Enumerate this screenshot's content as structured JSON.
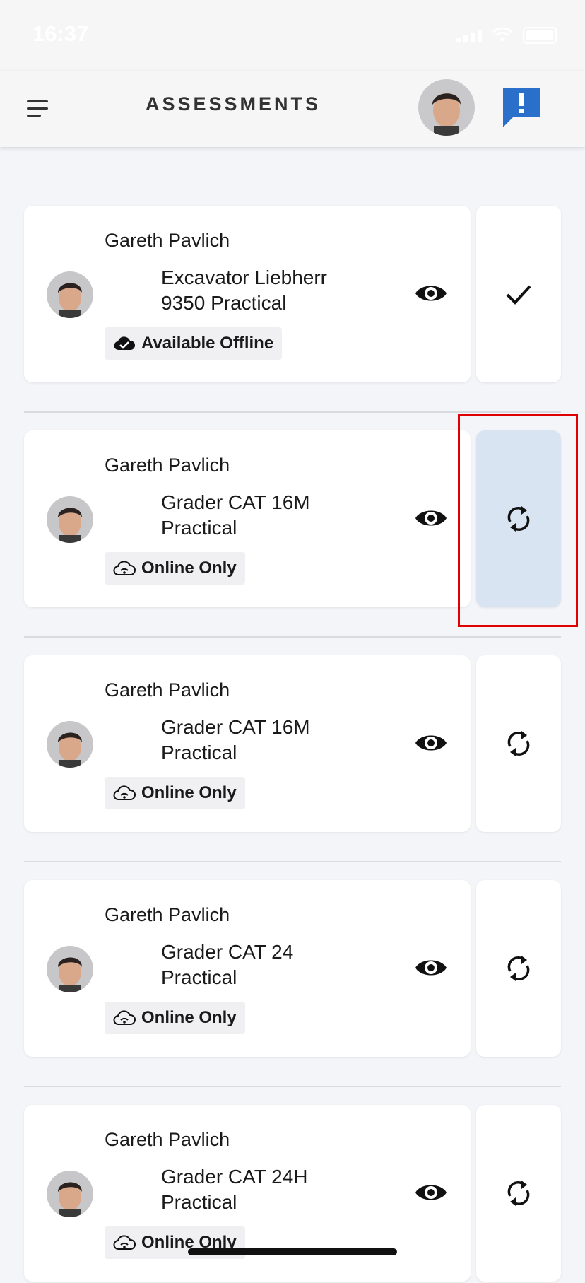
{
  "status_bar": {
    "time": "16:37"
  },
  "header": {
    "title": "ASSESSMENTS"
  },
  "assessments": [
    {
      "person": "Gareth Pavlich",
      "title": "Excavator Liebherr 9350 Practical",
      "status": "Available Offline",
      "status_icon": "cloud-check-icon",
      "action_icon": "check-icon"
    },
    {
      "person": "Gareth Pavlich",
      "title": "Grader CAT 16M Practical",
      "status": "Online Only",
      "status_icon": "cloud-wifi-icon",
      "action_icon": "sync-icon"
    },
    {
      "person": "Gareth Pavlich",
      "title": "Grader CAT 16M Practical",
      "status": "Online Only",
      "status_icon": "cloud-wifi-icon",
      "action_icon": "sync-icon"
    },
    {
      "person": "Gareth Pavlich",
      "title": "Grader CAT 24 Practical",
      "status": "Online Only",
      "status_icon": "cloud-wifi-icon",
      "action_icon": "sync-icon"
    },
    {
      "person": "Gareth Pavlich",
      "title": "Grader CAT 24H Practical",
      "status": "Online Only",
      "status_icon": "cloud-wifi-icon",
      "action_icon": "sync-icon"
    }
  ],
  "colors": {
    "background": "#f4f5f8",
    "card": "#ffffff",
    "selected_action": "#d9e4f3",
    "alert_button": "#2a6fc9",
    "highlight_border": "#e00000"
  }
}
